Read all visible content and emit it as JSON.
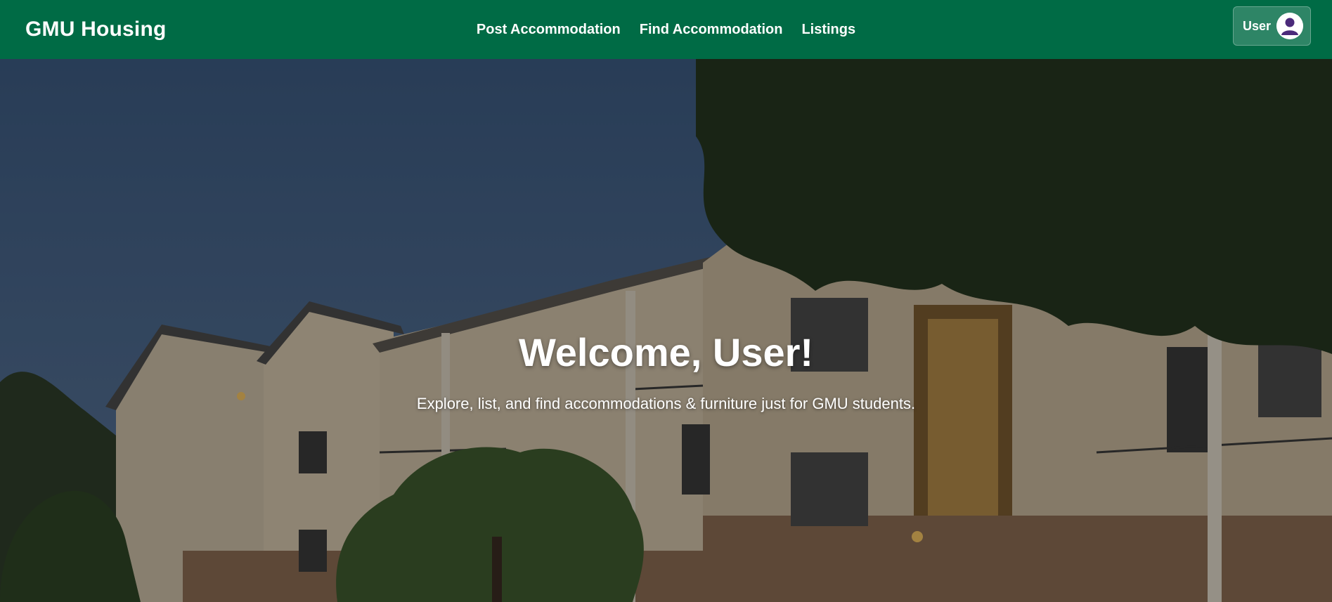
{
  "navbar": {
    "brand": "GMU Housing",
    "links": [
      {
        "label": "Post Accommodation"
      },
      {
        "label": "Find Accommodation"
      },
      {
        "label": "Listings"
      }
    ],
    "user_button": {
      "label": "User",
      "icon": "user-avatar-icon"
    }
  },
  "hero": {
    "title": "Welcome, User!",
    "subtitle": "Explore, list, and find accommodations & furniture just for GMU students."
  },
  "colors": {
    "navbar_bg": "#006b45",
    "text": "#ffffff",
    "avatar_figure": "#4b2a7a"
  }
}
